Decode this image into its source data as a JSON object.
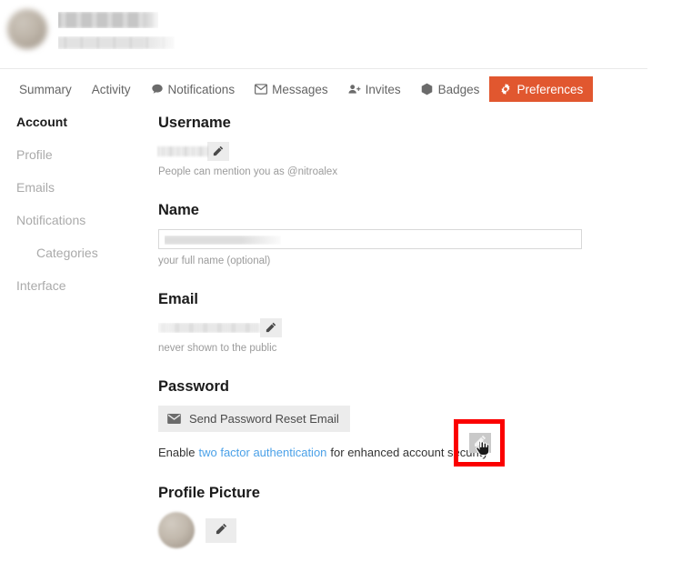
{
  "header": {
    "avatar_name": "user-avatar",
    "name_redacted": true,
    "handle_redacted": true
  },
  "nav": {
    "tabs": [
      {
        "label": "Summary",
        "icon": "",
        "active": false
      },
      {
        "label": "Activity",
        "icon": "",
        "active": false
      },
      {
        "label": "Notifications",
        "icon": "comment-icon",
        "active": false
      },
      {
        "label": "Messages",
        "icon": "envelope-icon",
        "active": false
      },
      {
        "label": "Invites",
        "icon": "user-plus-icon",
        "active": false
      },
      {
        "label": "Badges",
        "icon": "badge-icon",
        "active": false
      },
      {
        "label": "Preferences",
        "icon": "gear-icon",
        "active": true
      }
    ],
    "active_color": "#e1572f"
  },
  "sidebar": {
    "items": [
      {
        "label": "Account",
        "active": true,
        "nested": false
      },
      {
        "label": "Profile",
        "active": false,
        "nested": false
      },
      {
        "label": "Emails",
        "active": false,
        "nested": false
      },
      {
        "label": "Notifications",
        "active": false,
        "nested": false
      },
      {
        "label": "Categories",
        "active": false,
        "nested": true
      },
      {
        "label": "Interface",
        "active": false,
        "nested": false
      }
    ]
  },
  "main": {
    "username": {
      "label": "Username",
      "value": "",
      "help": "People can mention you as @nitroalex",
      "edit_icon": "pencil-icon"
    },
    "name": {
      "label": "Name",
      "value": "",
      "placeholder": "",
      "help": "your full name (optional)"
    },
    "email": {
      "label": "Email",
      "value": "",
      "help": "never shown to the public",
      "edit_icon": "pencil-icon"
    },
    "password": {
      "label": "Password",
      "reset_button_label": "Send Password Reset Email",
      "reset_button_icon": "envelope-icon",
      "twofa_prefix": "Enable",
      "twofa_link": "two factor authentication",
      "twofa_suffix": "for enhanced account security",
      "twofa_link_color": "#4ba1e8",
      "twofa_edit_icon": "pencil-icon"
    },
    "profile_picture": {
      "label": "Profile Picture",
      "edit_icon": "pencil-icon"
    }
  },
  "annotation": {
    "box_color": "#fb0000",
    "target_name": "two-factor-edit-button",
    "cursor": "hand-pointer-cursor"
  }
}
